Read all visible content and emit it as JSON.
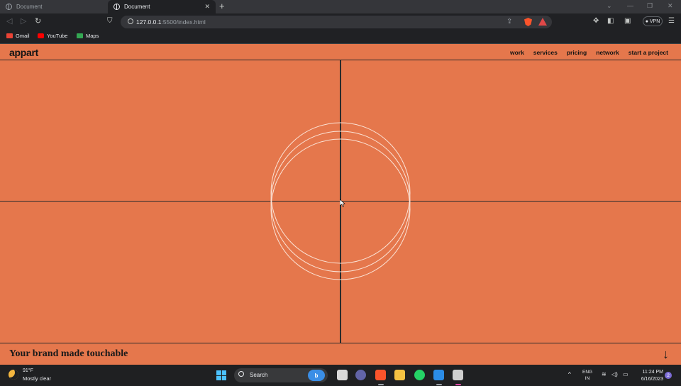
{
  "browser": {
    "tabs": [
      {
        "label": "Document"
      },
      {
        "label": "Document"
      }
    ],
    "new_tab": "+",
    "url_host": "127.0.0.1",
    "url_rest": ":5500/index.html",
    "vpn_label": "● VPN",
    "bookmarks": [
      {
        "label": "Gmail",
        "color": "#ea4335"
      },
      {
        "label": "YouTube",
        "color": "#ff0000"
      },
      {
        "label": "Maps",
        "color": "#34a853"
      }
    ]
  },
  "page": {
    "logo": "appart",
    "nav": [
      "work",
      "services",
      "pricing",
      "network",
      "start a project"
    ],
    "tagline": "Your brand made touchable",
    "scroll_arrow": "↓",
    "background": "#e5774c"
  },
  "taskbar": {
    "weather_temp": "91°F",
    "weather_condition": "Mostly clear",
    "search_label": "Search",
    "search_badge": "b",
    "lang_line1": "ENG",
    "lang_line2": "IN",
    "time": "11:24 PM",
    "date": "6/16/2023",
    "notification_count": "2"
  }
}
